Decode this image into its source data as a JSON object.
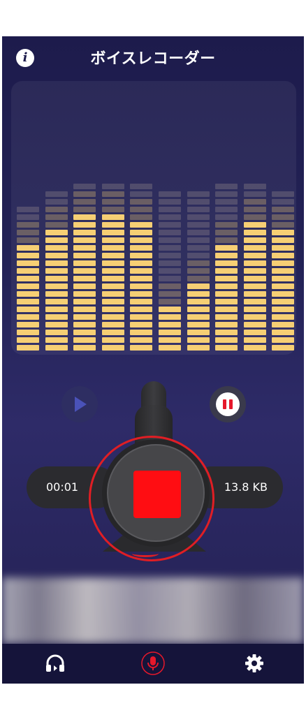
{
  "header": {
    "title": "ボイスレコーダー",
    "info_icon": "info-icon"
  },
  "visualizer": {
    "bar_color": "#f6cf74",
    "columns": [
      {
        "level": 0.42,
        "peak": 0.56
      },
      {
        "level": 0.48,
        "peak": 0.62
      },
      {
        "level": 0.52,
        "peak": 0.64
      },
      {
        "level": 0.52,
        "peak": 0.66
      },
      {
        "level": 0.5,
        "peak": 0.66
      },
      {
        "level": 0.18,
        "peak": 0.62
      },
      {
        "level": 0.26,
        "peak": 0.62
      },
      {
        "level": 0.42,
        "peak": 0.64
      },
      {
        "level": 0.5,
        "peak": 0.66
      },
      {
        "level": 0.46,
        "peak": 0.62
      }
    ]
  },
  "recorder": {
    "elapsed": "00:01",
    "file_size": "13.8 KB",
    "stop_color": "#ff0d12",
    "play_icon": "play-icon",
    "pause_icon": "pause-icon",
    "stop_icon": "stop-icon"
  },
  "nav": {
    "items": [
      {
        "icon": "headphones-icon",
        "active": false
      },
      {
        "icon": "microphone-icon",
        "active": true
      },
      {
        "icon": "gear-icon",
        "active": false
      }
    ],
    "active_color": "#e5182b"
  }
}
